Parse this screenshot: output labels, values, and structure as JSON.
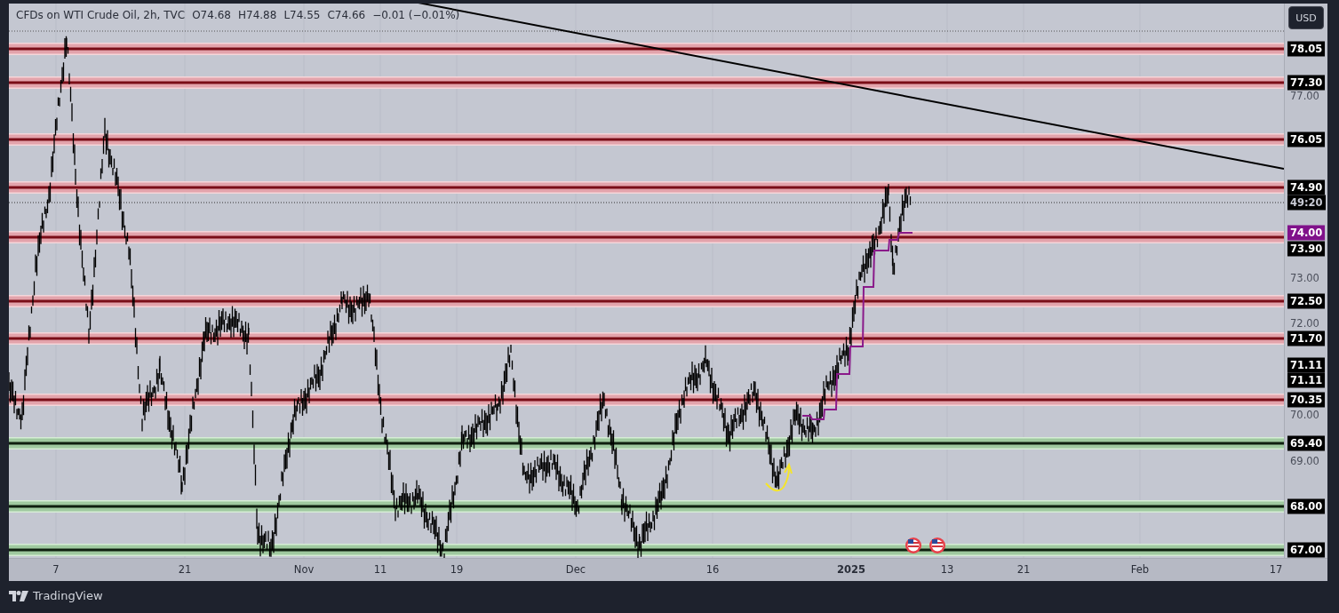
{
  "header": {
    "symbol": "CFDs on WTI Crude Oil, 2h, TVC",
    "open": "O74.68",
    "high": "H74.88",
    "low": "L74.55",
    "close": "C74.66",
    "change": "−0.01 (−0.01%)"
  },
  "currency_button": "USD",
  "levels": [
    {
      "kind": "resistance"
    },
    {
      "kind": "resistance"
    },
    {
      "kind": "resistance"
    },
    {
      "kind": "resistance"
    },
    {
      "kind": "resistance"
    },
    {
      "kind": "resistance"
    },
    {
      "kind": "resistance"
    },
    {
      "kind": "resistance"
    },
    {
      "kind": "support"
    },
    {
      "kind": "support"
    },
    {
      "kind": "support"
    }
  ],
  "price_axis": [
    {
      "text": "78.05",
      "kind": "level"
    },
    {
      "text": "77.30",
      "kind": "level"
    },
    {
      "text": "77.00",
      "kind": "tick"
    },
    {
      "text": "76.05",
      "kind": "level"
    },
    {
      "text": "74.90",
      "kind": "level"
    },
    {
      "text": "49:20",
      "kind": "countdown"
    },
    {
      "text": "74.00",
      "kind": "marker"
    },
    {
      "text": "73.90",
      "kind": "level"
    },
    {
      "text": "73.00",
      "kind": "tick"
    },
    {
      "text": "72.50",
      "kind": "level"
    },
    {
      "text": "72.00",
      "kind": "tick"
    },
    {
      "text": "71.70",
      "kind": "level"
    },
    {
      "text": "71.11",
      "kind": "level"
    },
    {
      "text": "71.11",
      "kind": "level"
    },
    {
      "text": "70.35",
      "kind": "level"
    },
    {
      "text": "70.00",
      "kind": "tick"
    },
    {
      "text": "69.40",
      "kind": "level"
    },
    {
      "text": "69.00",
      "kind": "tick"
    },
    {
      "text": "68.00",
      "kind": "level"
    },
    {
      "text": "67.00",
      "kind": "level"
    }
  ],
  "time_axis": [
    {
      "text": "7",
      "bold": false
    },
    {
      "text": "21",
      "bold": false
    },
    {
      "text": "Nov",
      "bold": false
    },
    {
      "text": "11",
      "bold": false
    },
    {
      "text": "19",
      "bold": false
    },
    {
      "text": "Dec",
      "bold": false
    },
    {
      "text": "16",
      "bold": false
    },
    {
      "text": "2025",
      "bold": true
    },
    {
      "text": "13",
      "bold": false
    },
    {
      "text": "21",
      "bold": false
    },
    {
      "text": "Feb",
      "bold": false
    },
    {
      "text": "17",
      "bold": false
    }
  ],
  "footer": {
    "brand": "TradingView"
  }
}
